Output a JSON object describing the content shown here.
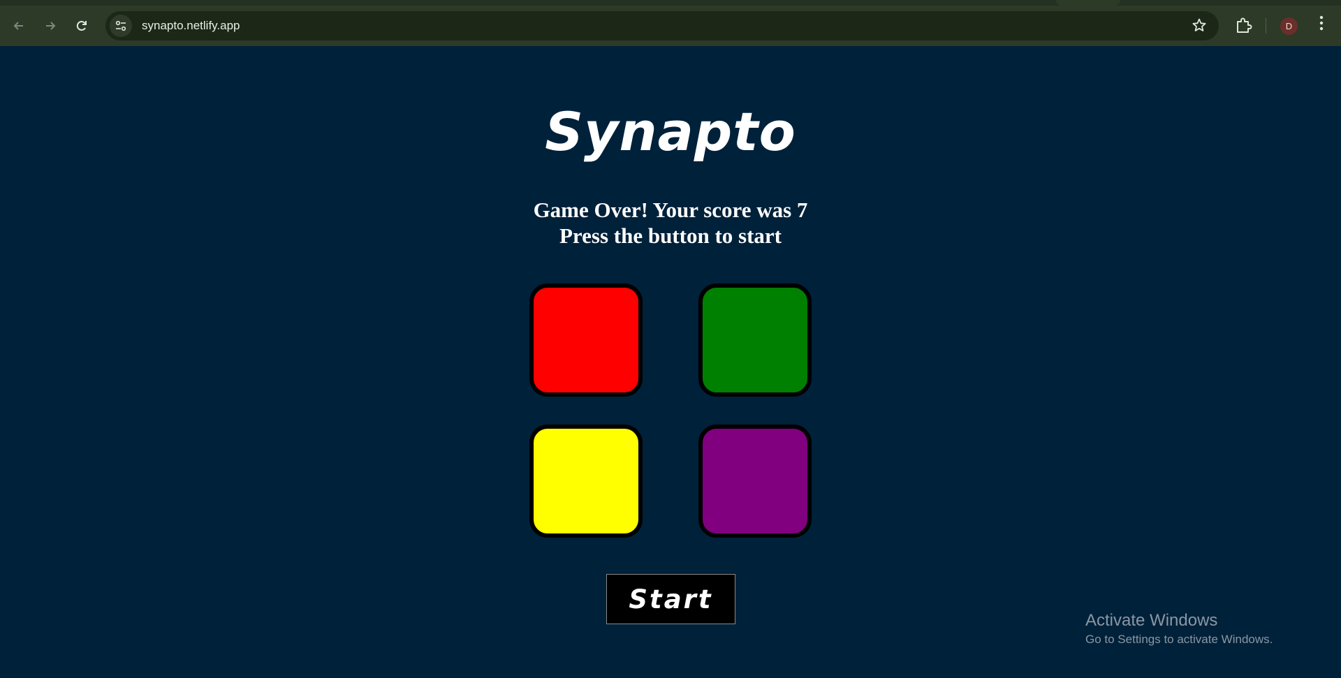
{
  "browser": {
    "url": "synapto.netlify.app",
    "profile_initial": "D",
    "icons": {
      "back": "arrow-left-icon",
      "forward": "arrow-right-icon",
      "reload": "reload-icon",
      "site_info": "site-settings-icon",
      "bookmark": "star-icon",
      "extensions": "puzzle-piece-icon",
      "menu": "kebab-menu-icon"
    }
  },
  "game": {
    "title": "Synapto",
    "status_line1": "Game Over! Your score was 7",
    "status_line2": "Press the button to start",
    "pads": [
      {
        "color": "#ff0000",
        "name": "red"
      },
      {
        "color": "#008000",
        "name": "green"
      },
      {
        "color": "#ffff00",
        "name": "yellow"
      },
      {
        "color": "#800080",
        "name": "purple"
      }
    ],
    "start_label": "Start"
  },
  "watermark": {
    "title": "Activate Windows",
    "subtitle": "Go to Settings to activate Windows."
  }
}
